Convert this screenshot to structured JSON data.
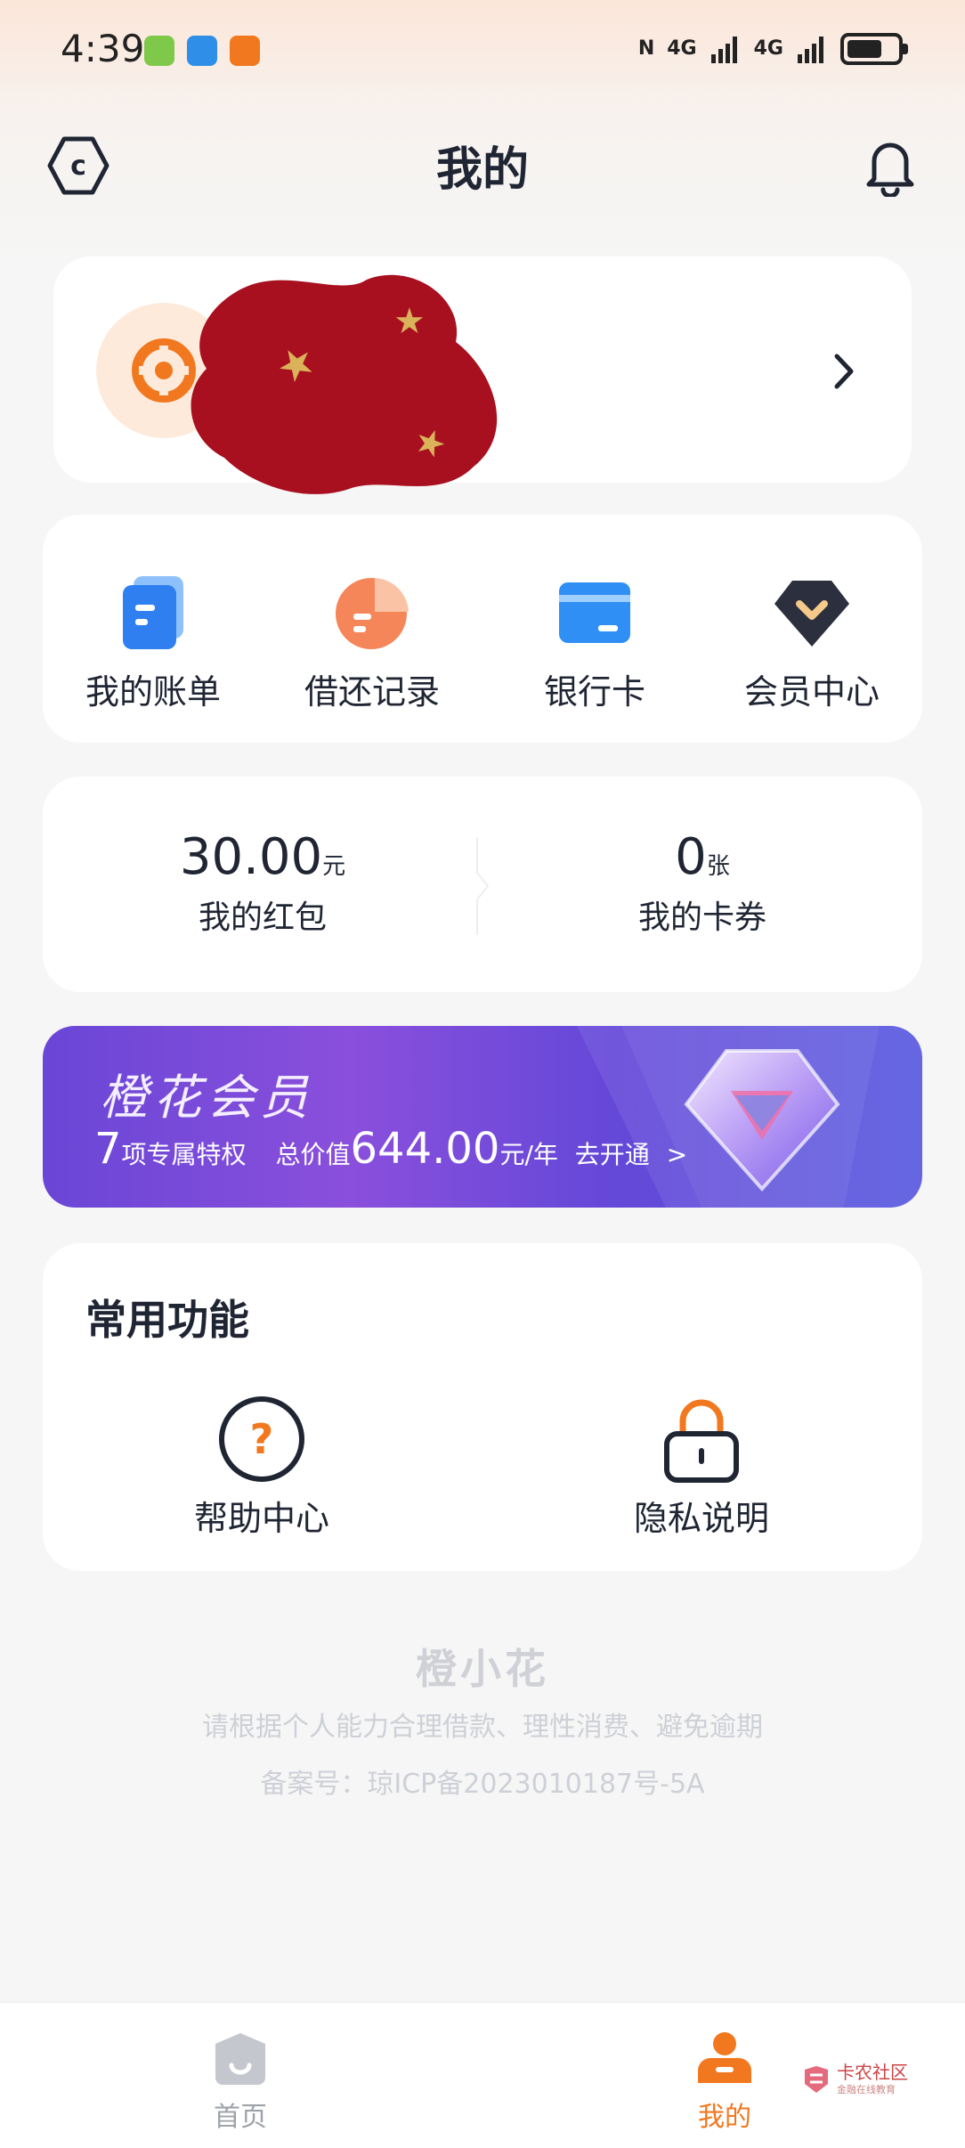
{
  "status_bar": {
    "time": "4:39",
    "network_1": "4G",
    "network_2": "4G"
  },
  "header": {
    "title": "我的",
    "left_icon": "c-hexagon-icon",
    "right_icon": "bell-icon"
  },
  "profile": {
    "avatar_icon": "brand-logo-icon",
    "name_redacted": "redacted-sticker"
  },
  "shortcuts": [
    {
      "label": "我的账单",
      "icon": "bill-icon"
    },
    {
      "label": "借还记录",
      "icon": "pie-chart-icon"
    },
    {
      "label": "银行卡",
      "icon": "bank-card-icon"
    },
    {
      "label": "会员中心",
      "icon": "member-center-icon"
    }
  ],
  "wallet": {
    "red_packet_value": "30.00",
    "red_packet_unit": "元",
    "red_packet_label": "我的红包",
    "coupon_value": "0",
    "coupon_unit": "张",
    "coupon_label": "我的卡券"
  },
  "vip": {
    "title": "橙花会员",
    "count": "7",
    "count_suffix": "项专属特权",
    "total_prefix": "总价值",
    "total_value": "644.00",
    "total_suffix": "元/年",
    "cta": "去开通",
    "cta_arrow": ">"
  },
  "common": {
    "title": "常用功能",
    "items": [
      {
        "label": "帮助中心",
        "icon": "help-circle-icon"
      },
      {
        "label": "隐私说明",
        "icon": "lock-icon"
      }
    ]
  },
  "footer": {
    "brand": "橙小花",
    "tip": "请根据个人能力合理借款、理性消费、避免逾期",
    "icp": "备案号：琼ICP备2023010187号-5A"
  },
  "bottom_nav": {
    "items": [
      {
        "label": "首页",
        "icon": "home-icon",
        "active": false
      },
      {
        "label": "我的",
        "icon": "profile-icon",
        "active": true
      }
    ]
  },
  "watermark": {
    "title": "卡农社区",
    "subtitle": "金融在线教育"
  },
  "colors": {
    "brand_orange": "#f2781f",
    "text_dark": "#1f2533",
    "vip_purple": "#7047d9",
    "footer_grey": "#cdd0d6"
  }
}
